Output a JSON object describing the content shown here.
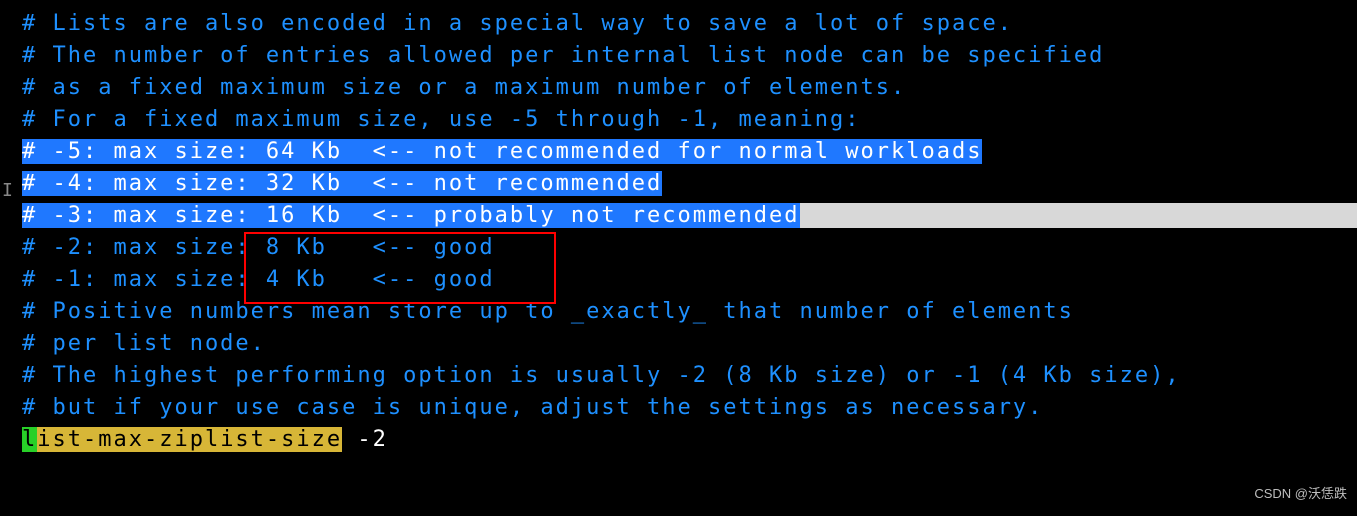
{
  "lines": {
    "l1": "# Lists are also encoded in a special way to save a lot of space.",
    "l2": "# The number of entries allowed per internal list node can be specified",
    "l3": "# as a fixed maximum size or a maximum number of elements.",
    "l4": "# For a fixed maximum size, use -5 through -1, meaning:",
    "l5": "# -5: max size: 64 Kb  <-- not recommended for normal workloads",
    "l6": "# -4: max size: 32 Kb  <-- not recommended",
    "l7": "# -3: max size: 16 Kb  <-- probably not recommended",
    "l8": "# -2: max size: 8 Kb   <-- good",
    "l9": "# -1: max size: 4 Kb   <-- good",
    "l10": "# Positive numbers mean store up to _exactly_ that number of elements",
    "l11": "# per list node.",
    "l12": "# The highest performing option is usually -2 (8 Kb size) or -1 (4 Kb size),",
    "l13": "# but if your use case is unique, adjust the settings as necessary."
  },
  "config": {
    "key_first": "l",
    "key_rest": "ist-max-ziplist-size",
    "value": " -2"
  },
  "watermark": "CSDN @沃恁跌"
}
